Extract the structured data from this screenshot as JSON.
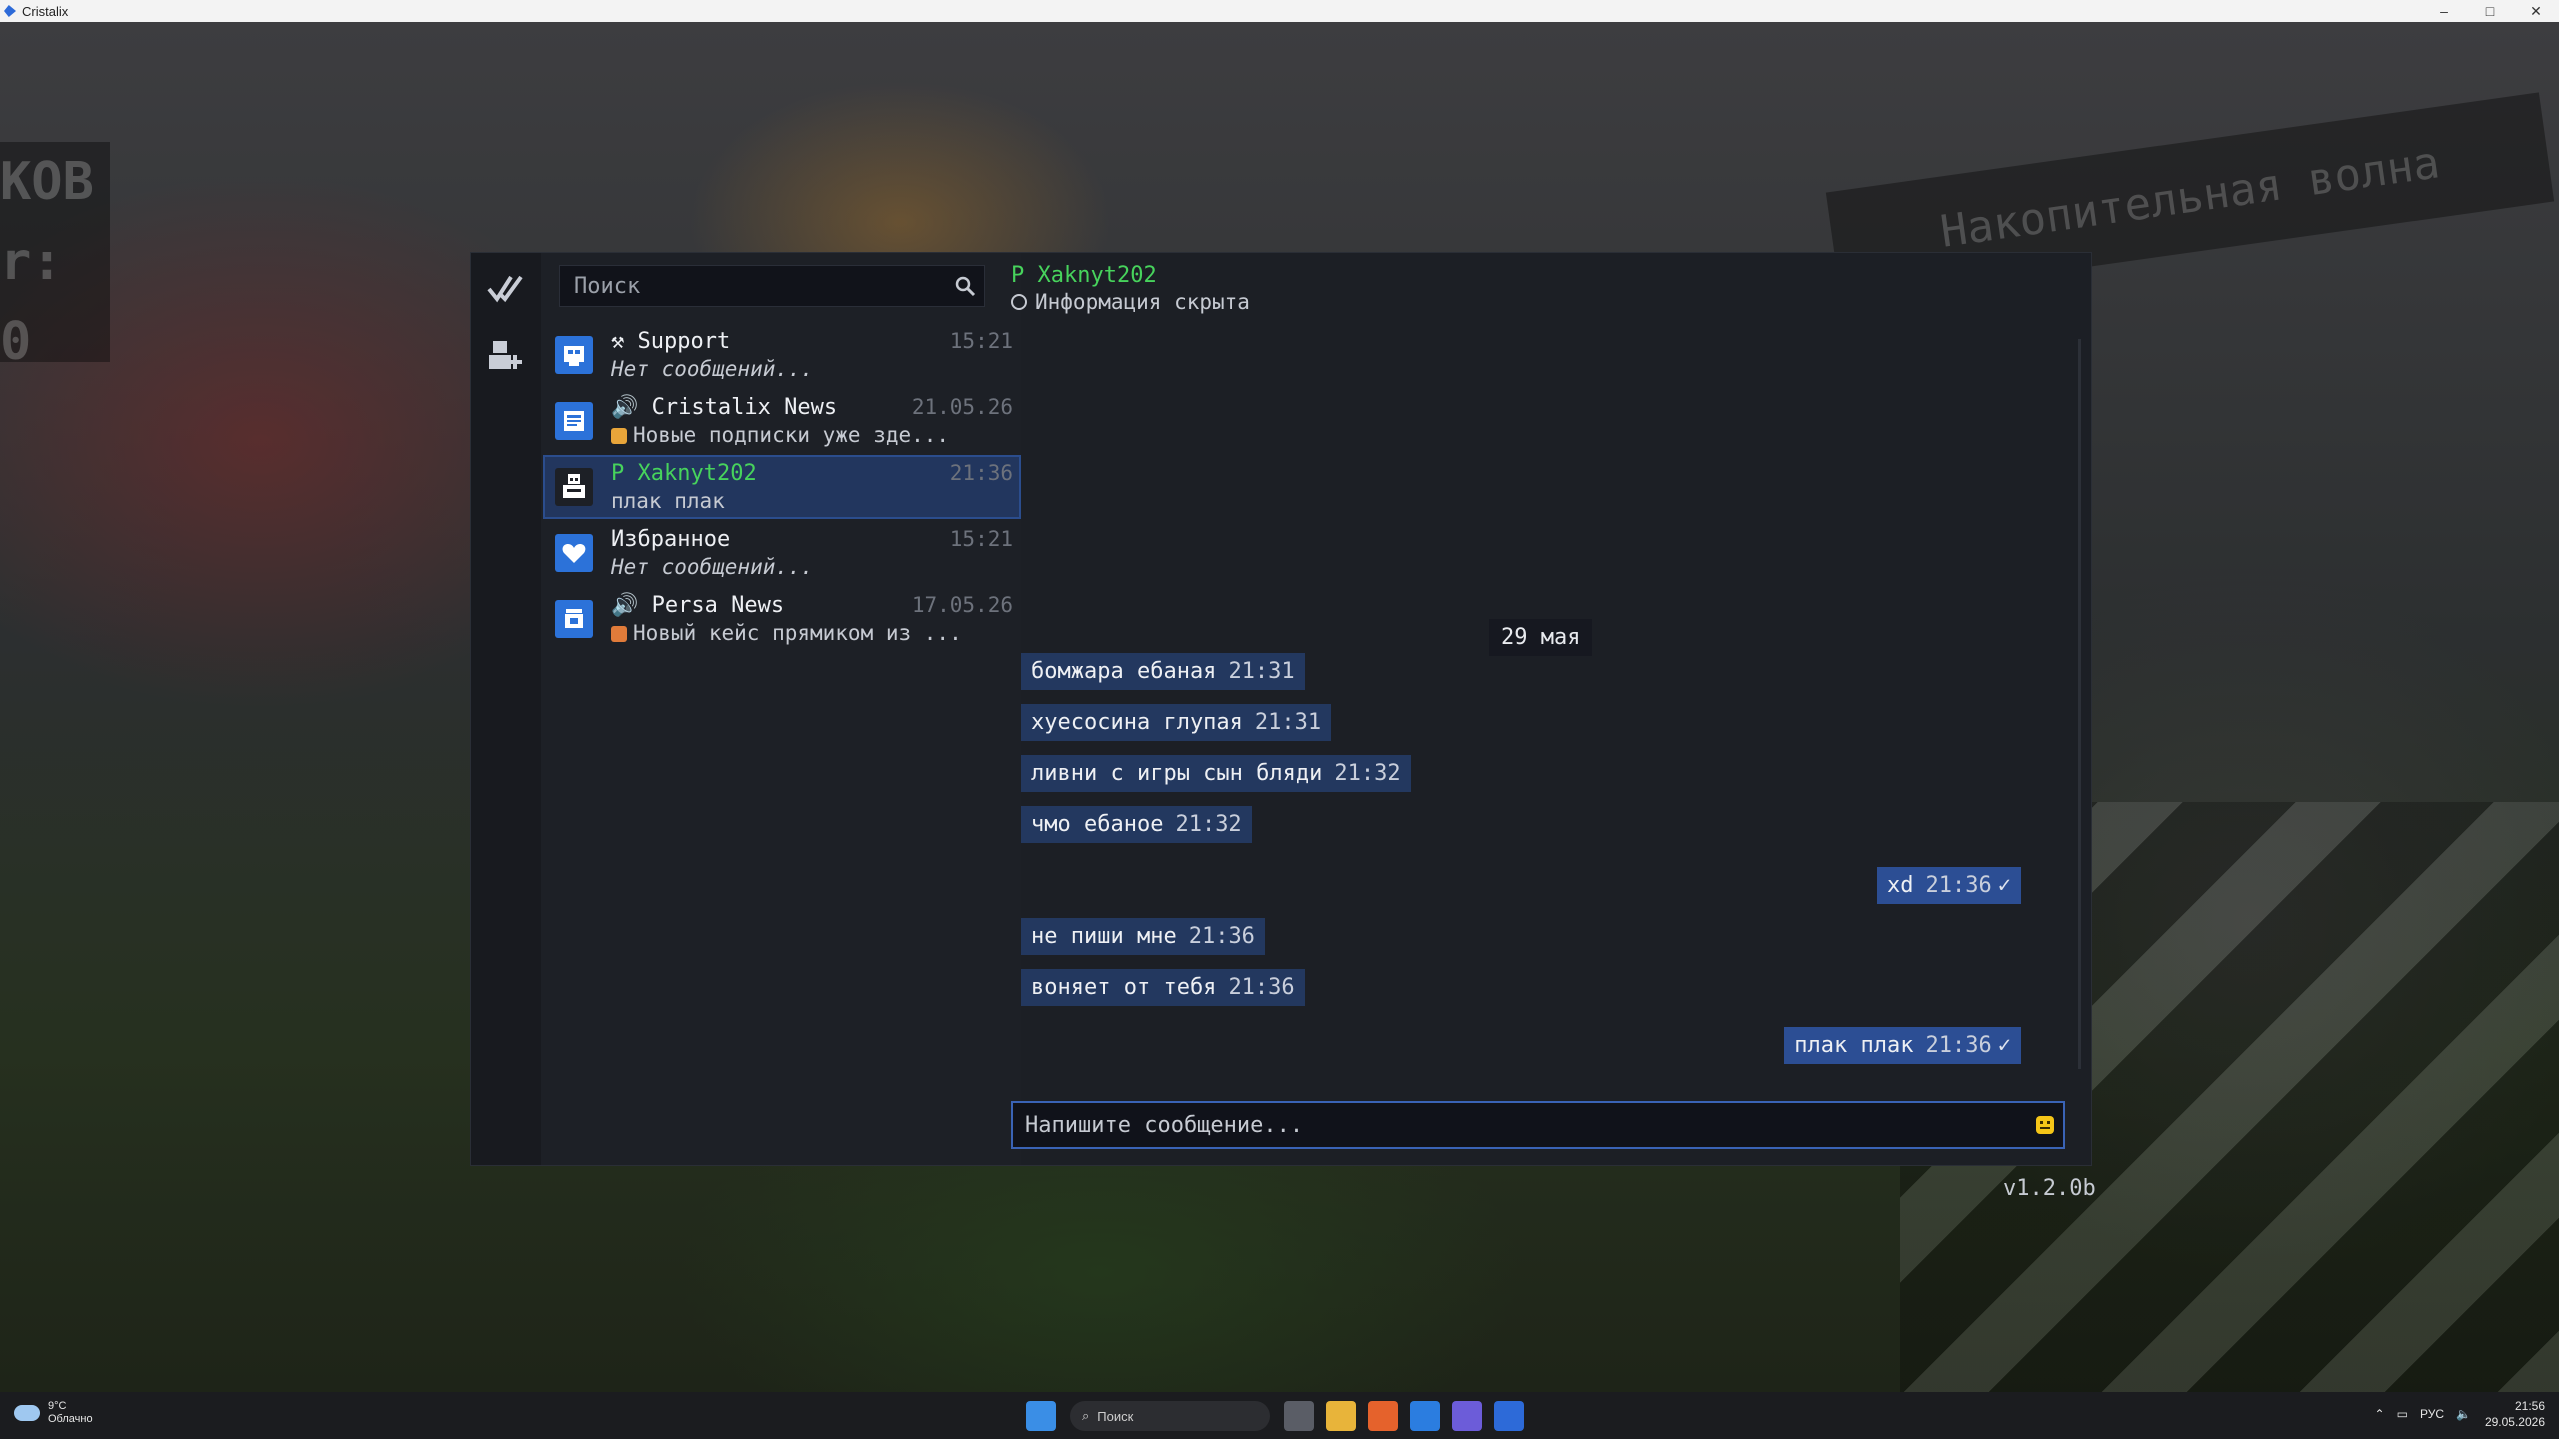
{
  "window": {
    "title": "Cristalix",
    "controls": {
      "minimize": "–",
      "maximize": "□",
      "close": "✕"
    }
  },
  "background": {
    "sign_text": "Накопительная волна",
    "scoreboard_text": [
      "КОВ",
      "r: 0"
    ]
  },
  "search": {
    "placeholder": "Поиск"
  },
  "conversations": [
    {
      "icon": "support-icon",
      "prefix": "⚒",
      "name": "Support",
      "preview": "Нет сообщений...",
      "time": "15:21",
      "preview_italic": true
    },
    {
      "icon": "news-icon",
      "prefix": "🔊",
      "name": "Cristalix News",
      "preview": "Новые подписки уже здe...",
      "time": "21.05.26",
      "preview_prefix_color": "#e8a53a"
    },
    {
      "icon": "bot-icon",
      "prefix": "P",
      "name": "Xaknyt202",
      "preview": "плак плак",
      "time": "21:36",
      "active": true
    },
    {
      "icon": "heart-icon",
      "prefix": "",
      "name": "Избранное",
      "preview": "Нет сообщений...",
      "time": "15:21",
      "preview_italic": true
    },
    {
      "icon": "persa-icon",
      "prefix": "🔊",
      "name": "Persa News",
      "preview": "Новый кейс прямиком из ...",
      "time": "17.05.26",
      "preview_prefix_color": "#e07b3a"
    }
  ],
  "chat": {
    "title": "P Xaknyt202",
    "status": "Информация скрыта",
    "date_divider": "29 мая",
    "messages": [
      {
        "text": "бомжара ебаная",
        "time": "21:31",
        "out": false
      },
      {
        "text": "хуесосина глупая",
        "time": "21:31",
        "out": false
      },
      {
        "text": "ливни с игры сын бляди",
        "time": "21:32",
        "out": false
      },
      {
        "text": "чмо ебаное",
        "time": "21:32",
        "out": false
      },
      {
        "text": "xd",
        "time": "21:36",
        "out": true,
        "tick": "✓"
      },
      {
        "text": "не пиши мне",
        "time": "21:36",
        "out": false
      },
      {
        "text": "воняет от тебя",
        "time": "21:36",
        "out": false
      },
      {
        "text": "плак плак",
        "time": "21:36",
        "out": true,
        "tick": "✓"
      }
    ],
    "compose_placeholder": "Напишите сообщение..."
  },
  "version": "v1.2.0b",
  "taskbar": {
    "weather_temp": "9°C",
    "weather_desc": "Облачно",
    "search_placeholder": "Поиск",
    "lang": "РУС",
    "time": "21:56",
    "date": "29.05.2026"
  },
  "colors": {
    "accent": "#2c72d9",
    "username": "#47d35c",
    "bubble_in": "#23385f",
    "bubble_out": "#2c4e94"
  }
}
